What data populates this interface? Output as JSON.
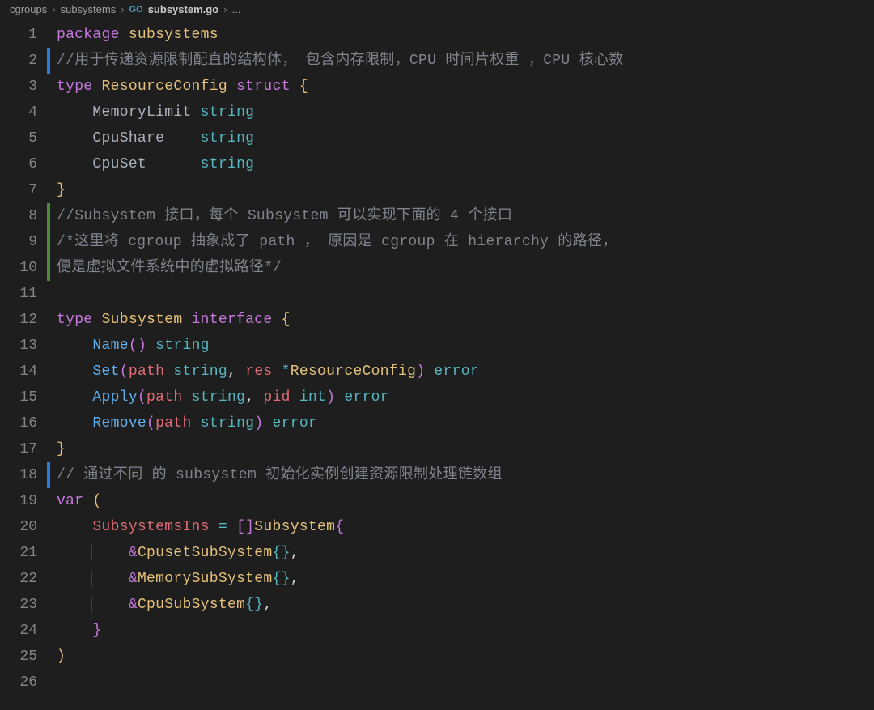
{
  "breadcrumb": {
    "items": [
      "cgroups",
      "subsystems",
      "subsystem.go",
      "..."
    ],
    "fileIcon": "GO"
  },
  "lines": [
    {
      "n": 1,
      "git": "",
      "tokens": [
        [
          "keyword",
          "package"
        ],
        [
          "plain",
          " "
        ],
        [
          "package",
          "subsystems"
        ]
      ]
    },
    {
      "n": 2,
      "git": "modified",
      "tokens": [
        [
          "comment",
          "//用于传递资源限制配直的结构体， 包含内存限制，CPU 时间片权重 ，CPU 核心数"
        ]
      ]
    },
    {
      "n": 3,
      "git": "",
      "tokens": [
        [
          "keyword",
          "type"
        ],
        [
          "plain",
          " "
        ],
        [
          "type",
          "ResourceConfig"
        ],
        [
          "plain",
          " "
        ],
        [
          "keyword",
          "struct"
        ],
        [
          "plain",
          " "
        ],
        [
          "punct",
          "{"
        ]
      ]
    },
    {
      "n": 4,
      "git": "",
      "tokens": [
        [
          "indent",
          "    "
        ],
        [
          "field",
          "MemoryLimit"
        ],
        [
          "plain",
          " "
        ],
        [
          "typeDef",
          "string"
        ]
      ]
    },
    {
      "n": 5,
      "git": "",
      "tokens": [
        [
          "indent",
          "    "
        ],
        [
          "field",
          "CpuShare"
        ],
        [
          "plain",
          "    "
        ],
        [
          "typeDef",
          "string"
        ]
      ]
    },
    {
      "n": 6,
      "git": "",
      "tokens": [
        [
          "indent",
          "    "
        ],
        [
          "field",
          "CpuSet"
        ],
        [
          "plain",
          "      "
        ],
        [
          "typeDef",
          "string"
        ]
      ]
    },
    {
      "n": 7,
      "git": "",
      "tokens": [
        [
          "punct",
          "}"
        ]
      ]
    },
    {
      "n": 8,
      "git": "added",
      "tokens": [
        [
          "comment",
          "//Subsystem 接口，每个 Subsystem 可以实现下面的 4 个接口"
        ]
      ]
    },
    {
      "n": 9,
      "git": "added",
      "tokens": [
        [
          "comment",
          "/*这里将 cgroup 抽象成了 path ， 原因是 cgroup 在 hierarchy 的路径，"
        ]
      ]
    },
    {
      "n": 10,
      "git": "added",
      "tokens": [
        [
          "comment",
          "便是虚拟文件系统中的虚拟路径*/"
        ]
      ]
    },
    {
      "n": 11,
      "git": "",
      "tokens": []
    },
    {
      "n": 12,
      "git": "",
      "tokens": [
        [
          "keyword",
          "type"
        ],
        [
          "plain",
          " "
        ],
        [
          "type",
          "Subsystem"
        ],
        [
          "plain",
          " "
        ],
        [
          "keyword",
          "interface"
        ],
        [
          "plain",
          " "
        ],
        [
          "punct",
          "{"
        ]
      ]
    },
    {
      "n": 13,
      "git": "",
      "tokens": [
        [
          "indent",
          "    "
        ],
        [
          "method",
          "Name"
        ],
        [
          "paren",
          "()"
        ],
        [
          "plain",
          " "
        ],
        [
          "typeDef",
          "string"
        ]
      ]
    },
    {
      "n": 14,
      "git": "",
      "tokens": [
        [
          "indent",
          "    "
        ],
        [
          "method",
          "Set"
        ],
        [
          "paren",
          "("
        ],
        [
          "param",
          "path"
        ],
        [
          "plain",
          " "
        ],
        [
          "typeDef",
          "string"
        ],
        [
          "plain",
          ", "
        ],
        [
          "param",
          "res"
        ],
        [
          "plain",
          " "
        ],
        [
          "operator",
          "*"
        ],
        [
          "type",
          "ResourceConfig"
        ],
        [
          "paren",
          ")"
        ],
        [
          "plain",
          " "
        ],
        [
          "typeDef",
          "error"
        ]
      ]
    },
    {
      "n": 15,
      "git": "",
      "tokens": [
        [
          "indent",
          "    "
        ],
        [
          "method",
          "Apply"
        ],
        [
          "paren",
          "("
        ],
        [
          "param",
          "path"
        ],
        [
          "plain",
          " "
        ],
        [
          "typeDef",
          "string"
        ],
        [
          "plain",
          ", "
        ],
        [
          "param",
          "pid"
        ],
        [
          "plain",
          " "
        ],
        [
          "typeDef",
          "int"
        ],
        [
          "paren",
          ")"
        ],
        [
          "plain",
          " "
        ],
        [
          "typeDef",
          "error"
        ]
      ]
    },
    {
      "n": 16,
      "git": "",
      "tokens": [
        [
          "indent",
          "    "
        ],
        [
          "method",
          "Remove"
        ],
        [
          "paren",
          "("
        ],
        [
          "param",
          "path"
        ],
        [
          "plain",
          " "
        ],
        [
          "typeDef",
          "string"
        ],
        [
          "paren",
          ")"
        ],
        [
          "plain",
          " "
        ],
        [
          "typeDef",
          "error"
        ]
      ]
    },
    {
      "n": 17,
      "git": "",
      "tokens": [
        [
          "punct",
          "}"
        ]
      ]
    },
    {
      "n": 18,
      "git": "modified",
      "tokens": [
        [
          "comment",
          "// 通过不同 的 subsystem 初始化实例创建资源限制处理链数组"
        ]
      ]
    },
    {
      "n": 19,
      "git": "",
      "tokens": [
        [
          "keyword",
          "var"
        ],
        [
          "plain",
          " "
        ],
        [
          "punct",
          "("
        ]
      ]
    },
    {
      "n": 20,
      "git": "",
      "tokens": [
        [
          "indent",
          "    "
        ],
        [
          "var",
          "SubsystemsIns"
        ],
        [
          "plain",
          " "
        ],
        [
          "operator",
          "="
        ],
        [
          "plain",
          " "
        ],
        [
          "paren",
          "[]"
        ],
        [
          "type",
          "Subsystem"
        ],
        [
          "paren",
          "{"
        ]
      ]
    },
    {
      "n": 21,
      "git": "",
      "tokens": [
        [
          "indent",
          "        "
        ],
        [
          "amp",
          "&"
        ],
        [
          "type",
          "CpusetSubSystem"
        ],
        [
          "bracket",
          "{}"
        ],
        [
          "plain",
          ","
        ]
      ]
    },
    {
      "n": 22,
      "git": "",
      "tokens": [
        [
          "indent",
          "        "
        ],
        [
          "amp",
          "&"
        ],
        [
          "type",
          "MemorySubSystem"
        ],
        [
          "bracket",
          "{}"
        ],
        [
          "plain",
          ","
        ]
      ]
    },
    {
      "n": 23,
      "git": "",
      "tokens": [
        [
          "indent",
          "        "
        ],
        [
          "amp",
          "&"
        ],
        [
          "type",
          "CpuSubSystem"
        ],
        [
          "bracket",
          "{}"
        ],
        [
          "plain",
          ","
        ]
      ]
    },
    {
      "n": 24,
      "git": "",
      "tokens": [
        [
          "indent",
          "    "
        ],
        [
          "paren",
          "}"
        ]
      ]
    },
    {
      "n": 25,
      "git": "",
      "tokens": [
        [
          "punct",
          ")"
        ]
      ]
    },
    {
      "n": 26,
      "git": "",
      "tokens": []
    }
  ]
}
